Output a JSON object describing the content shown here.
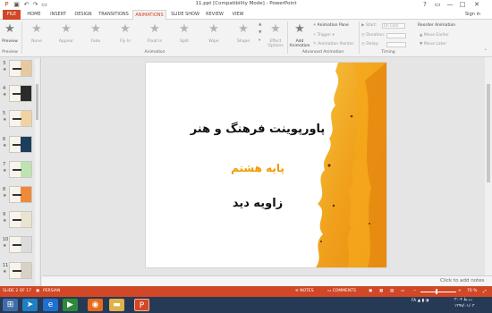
{
  "window": {
    "title": "11.ppt [Compatibility Mode] - PowerPoint",
    "controls": [
      "?",
      "▭",
      "—",
      "□",
      "✕"
    ]
  },
  "tabs": [
    "FILE",
    "HOME",
    "INSERT",
    "DESIGN",
    "TRANSITIONS",
    "ANIMATIONS",
    "SLIDE SHOW",
    "REVIEW",
    "VIEW"
  ],
  "active_tab": "ANIMATIONS",
  "sign_in": "Sign in",
  "ribbon": {
    "preview": "Preview",
    "preview_group": "Preview",
    "animations": [
      "None",
      "Appear",
      "Fade",
      "Fly In",
      "Float In",
      "Split",
      "Wipe",
      "Shape"
    ],
    "effect_options": "Effect Options",
    "animation_group": "Animation",
    "add_animation": "Add Animation",
    "animation_pane": "Animation Pane",
    "trigger": "Trigger",
    "animation_painter": "Animation Painter",
    "advanced_group": "Advanced Animation",
    "start_label": "Start:",
    "start_value": "On Click",
    "duration_label": "Duration:",
    "delay_label": "Delay:",
    "timing_group": "Timing",
    "reorder_title": "Reorder Animation",
    "move_earlier": "Move Earlier",
    "move_later": "Move Later"
  },
  "thumbnails": [
    {
      "num": "3",
      "bg": "#e7c9a0"
    },
    {
      "num": "4",
      "bg": "#2b2b2b"
    },
    {
      "num": "5",
      "bg": "#f1d3a3"
    },
    {
      "num": "6",
      "bg": "#1d3d5c"
    },
    {
      "num": "7",
      "bg": "#bfe3b0"
    },
    {
      "num": "8",
      "bg": "#ef8a3a"
    },
    {
      "num": "9",
      "bg": "#e8e4cf"
    },
    {
      "num": "10",
      "bg": "#dcdcdc"
    },
    {
      "num": "11",
      "bg": "#d9d2c4"
    }
  ],
  "slide": {
    "line1": "پاورپوینت فرهنگ و هنر",
    "line2": "پایه هشتم",
    "line3": "زاویه دید",
    "line1_color": "#111111",
    "line2_color": "#f29b00",
    "line3_color": "#111111"
  },
  "notes_hint": "Click to add notes",
  "status": {
    "slide_of": "SLIDE 2 OF 17",
    "language": "PERSIAN",
    "notes": "NOTES",
    "comments": "COMMENTS",
    "zoom": "70 %"
  },
  "taskbar": {
    "lang": "FA",
    "time": "۳:۰۴ ب.ظ",
    "date": "۱۳۹۷/۰۱/۰۳"
  },
  "colors": {
    "accent": "#d24726",
    "taskbar": "#273a55"
  }
}
